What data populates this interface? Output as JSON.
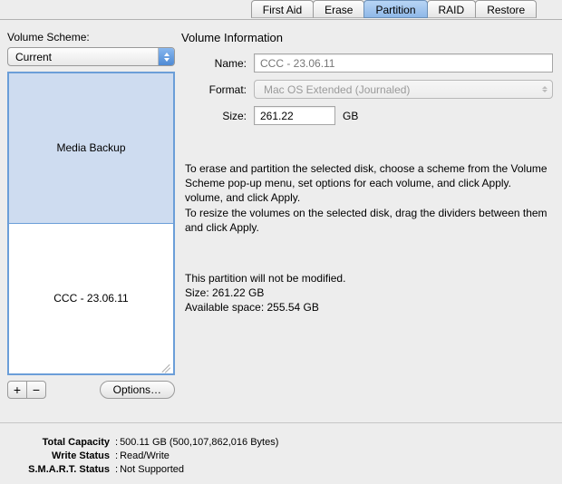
{
  "tabs": [
    "First Aid",
    "Erase",
    "Partition",
    "RAID",
    "Restore"
  ],
  "left": {
    "scheme_label": "Volume Scheme:",
    "scheme_value": "Current",
    "partitions": [
      {
        "name": "Media Backup"
      },
      {
        "name": "CCC - 23.06.11"
      }
    ],
    "options_label": "Options…"
  },
  "right": {
    "heading": "Volume Information",
    "name_label": "Name:",
    "name_value": "CCC - 23.06.11",
    "format_label": "Format:",
    "format_value": "Mac OS Extended (Journaled)",
    "size_label": "Size:",
    "size_value": "261.22",
    "size_unit": "GB",
    "instructions": [
      "To erase and partition the selected disk, choose a scheme from the Volume Scheme pop-up menu, set options for each volume, and click Apply.",
      "volume, and click Apply.",
      "To resize the volumes on the selected disk, drag the dividers between them and click Apply."
    ],
    "status": [
      "This partition will not be modified.",
      "Size: 261.22 GB",
      "Available space: 255.54 GB"
    ]
  },
  "footer": {
    "rows": [
      {
        "k": "Total Capacity",
        "v": "500.11 GB (500,107,862,016 Bytes)"
      },
      {
        "k": "Write Status",
        "v": "Read/Write"
      },
      {
        "k": "S.M.A.R.T. Status",
        "v": "Not Supported"
      }
    ]
  }
}
